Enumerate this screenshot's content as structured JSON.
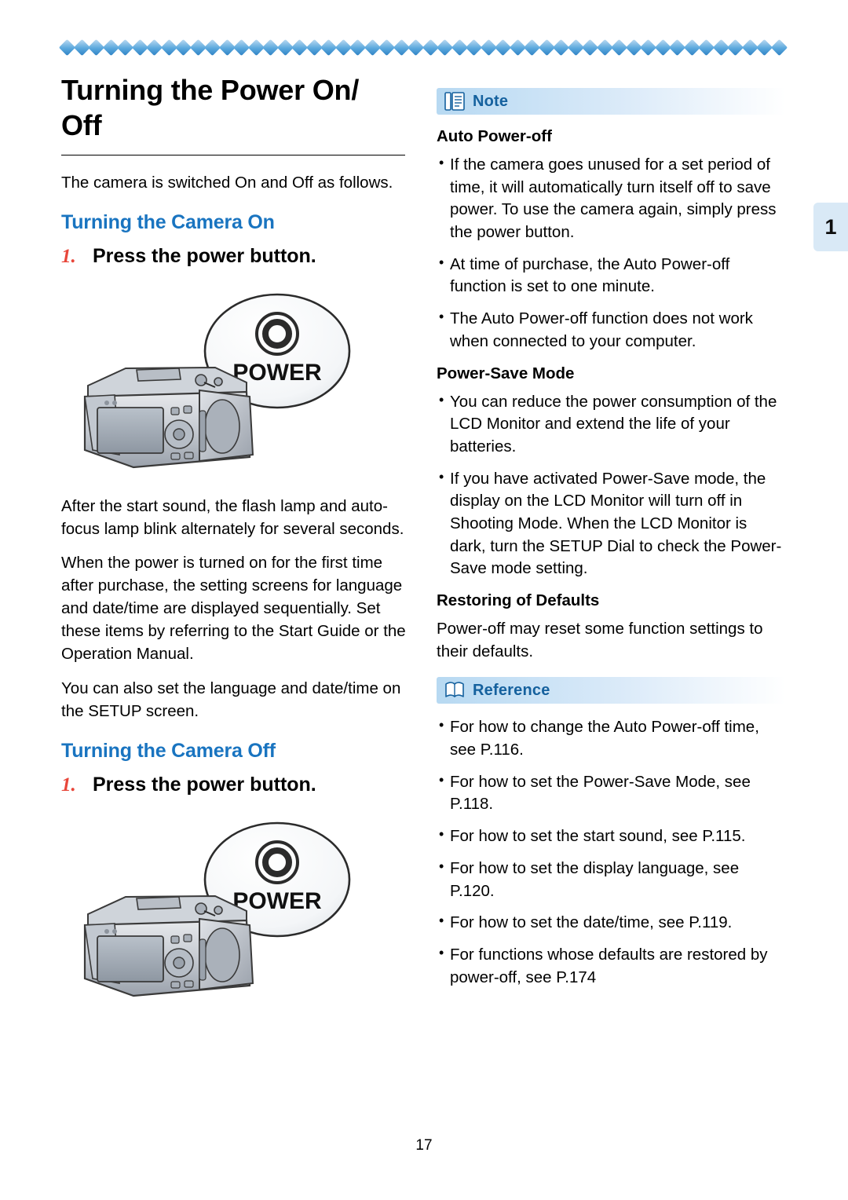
{
  "page": {
    "number": "17",
    "tab_number": "1"
  },
  "left": {
    "title": "Turning the Power On/ Off",
    "intro": "The camera is switched On and Off as follows.",
    "section_on": "Turning the Camera On",
    "step_on": {
      "num": "1.",
      "text": "Press the power button."
    },
    "power_label_on": "POWER",
    "para_after_1": "After the start sound, the flash lamp and auto-focus lamp blink alternately for several seconds.",
    "para_after_2": "When the power is turned on for the first time after purchase, the setting screens for language and date/time are displayed sequentially. Set these items by referring to the Start Guide or the Operation Manual.",
    "para_after_3": "You can also set the language and date/time on the SETUP screen.",
    "section_off": "Turning the Camera Off",
    "step_off": {
      "num": "1.",
      "text": "Press the power button."
    },
    "power_label_off": "POWER"
  },
  "right": {
    "note_banner": "Note",
    "note_icon": "note-pad-icon",
    "heading_auto_power_off": "Auto Power-off",
    "auto_power_off_bullets": [
      "If the camera goes unused for a set period of time, it will automatically turn itself off to save power. To use the camera again, simply press the power button.",
      "At time of purchase, the Auto Power-off function is set to one minute.",
      "The Auto Power-off function does not work when connected to your computer."
    ],
    "heading_power_save": "Power-Save Mode",
    "power_save_bullets": [
      "You can reduce the power consumption of the LCD Monitor and extend the life of your batteries.",
      "If you have activated Power-Save mode, the display on the LCD Monitor will turn off in Shooting Mode. When the LCD Monitor is dark, turn the SETUP Dial to check the Power-Save mode setting."
    ],
    "heading_restoring": "Restoring of Defaults",
    "restoring_text": "Power-off may reset some function settings to their defaults.",
    "reference_banner": "Reference",
    "reference_icon": "book-icon",
    "reference_bullets": [
      "For how to change the Auto Power-off time, see P.116.",
      "For how to set the Power-Save Mode, see P.118.",
      "For how to set the start sound, see P.115.",
      "For how to set the display language, see P.120.",
      "For how to set the date/time, see P.119.",
      "For functions whose defaults are restored by power-off, see P.174"
    ]
  },
  "colors": {
    "accent_blue": "#1974c0",
    "step_red": "#e8463a",
    "banner_blue": "#b7d9f2",
    "tab_blue": "#d9e9f6"
  }
}
